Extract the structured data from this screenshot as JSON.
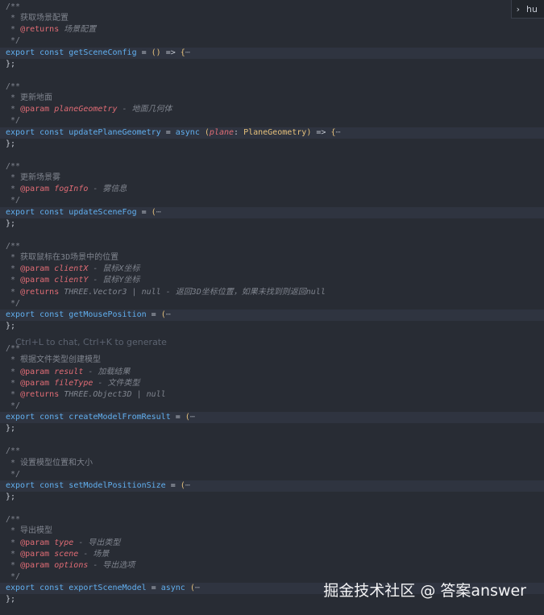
{
  "badge": {
    "chevron": "›",
    "text": "hu"
  },
  "hint": "Ctrl+L to chat, Ctrl+K to generate",
  "watermark": "掘金技术社区 @ 答案answer",
  "code": {
    "b1": {
      "c_open": "/**",
      "c_desc": " * 获取场景配置",
      "c_ret_star": " * ",
      "c_ret_tag": "@returns",
      "c_ret_text": " 场景配置",
      "c_close": " */",
      "kw_export": "export",
      "kw_const": "const",
      "fn": "getSceneConfig",
      "eq": " = ",
      "paren": "()",
      "arrow": " => ",
      "brace": "{",
      "ellipsis": "⋯",
      "end": "};"
    },
    "b2": {
      "c_open": "/**",
      "c_desc": " * 更新地面",
      "c_p_star": " * ",
      "c_p_tag": "@param",
      "c_p_name": "planeGeometry",
      "c_p_text": " - 地面几何体",
      "c_close": " */",
      "kw_export": "export",
      "kw_const": "const",
      "fn": "updatePlaneGeometry",
      "eq": " = ",
      "async": "async",
      "lparen": " (",
      "param": "plane",
      "colon": ": ",
      "type": "PlaneGeometry",
      "rparen": ")",
      "arrow": " => ",
      "brace": "{",
      "ellipsis": "⋯",
      "end": "};"
    },
    "b3": {
      "c_open": "/**",
      "c_desc": " * 更新场景雾",
      "c_p_star": " * ",
      "c_p_tag": "@param",
      "c_p_name": "fogInfo",
      "c_p_text": " - 雾信息",
      "c_close": " */",
      "kw_export": "export",
      "kw_const": "const",
      "fn": "updateSceneFog",
      "eq": " = ",
      "paren": "(",
      "ellipsis": "⋯",
      "end": "};"
    },
    "b4": {
      "c_open": "/**",
      "c_desc": " * 获取鼠标在3D场景中的位置",
      "c_p1_star": " * ",
      "c_p1_tag": "@param",
      "c_p1_name": "clientX",
      "c_p1_text": " - 鼠标X坐标",
      "c_p2_star": " * ",
      "c_p2_tag": "@param",
      "c_p2_name": "clientY",
      "c_p2_text": " - 鼠标Y坐标",
      "c_ret_star": " * ",
      "c_ret_tag": "@returns",
      "c_ret_text": " THREE.Vector3 | null - 返回3D坐标位置，如果未找到则返回null",
      "c_close": " */",
      "kw_export": "export",
      "kw_const": "const",
      "fn": "getMousePosition",
      "eq": " = ",
      "paren": "(",
      "ellipsis": "⋯",
      "end": "};"
    },
    "b5": {
      "c_open": "/**",
      "c_desc": " * 根据文件类型创建模型",
      "c_p1_star": " * ",
      "c_p1_tag": "@param",
      "c_p1_name": "result",
      "c_p1_text": " - 加载结果",
      "c_p2_star": " * ",
      "c_p2_tag": "@param",
      "c_p2_name": "fileType",
      "c_p2_text": " - 文件类型",
      "c_ret_star": " * ",
      "c_ret_tag": "@returns",
      "c_ret_text": " THREE.Object3D | null",
      "c_close": " */",
      "kw_export": "export",
      "kw_const": "const",
      "fn": "createModelFromResult",
      "eq": " = ",
      "paren": "(",
      "ellipsis": "⋯",
      "end": "};"
    },
    "b6": {
      "c_open": "/**",
      "c_desc": " * 设置模型位置和大小",
      "c_close": " */",
      "kw_export": "export",
      "kw_const": "const",
      "fn": "setModelPositionSize",
      "eq": " = ",
      "paren": "(",
      "ellipsis": "⋯",
      "end": "};"
    },
    "b7": {
      "c_open": "/**",
      "c_desc": " * 导出模型",
      "c_p1_star": " * ",
      "c_p1_tag": "@param",
      "c_p1_name": "type",
      "c_p1_text": " - 导出类型",
      "c_p2_star": " * ",
      "c_p2_tag": "@param",
      "c_p2_name": "scene",
      "c_p2_text": " - 场景",
      "c_p3_star": " * ",
      "c_p3_tag": "@param",
      "c_p3_name": "options",
      "c_p3_text": " - 导出选项",
      "c_close": " */",
      "kw_export": "export",
      "kw_const": "const",
      "fn": "exportSceneModel",
      "eq": " = ",
      "async": "async",
      "paren": " (",
      "ellipsis": "⋯",
      "end": "};"
    }
  }
}
